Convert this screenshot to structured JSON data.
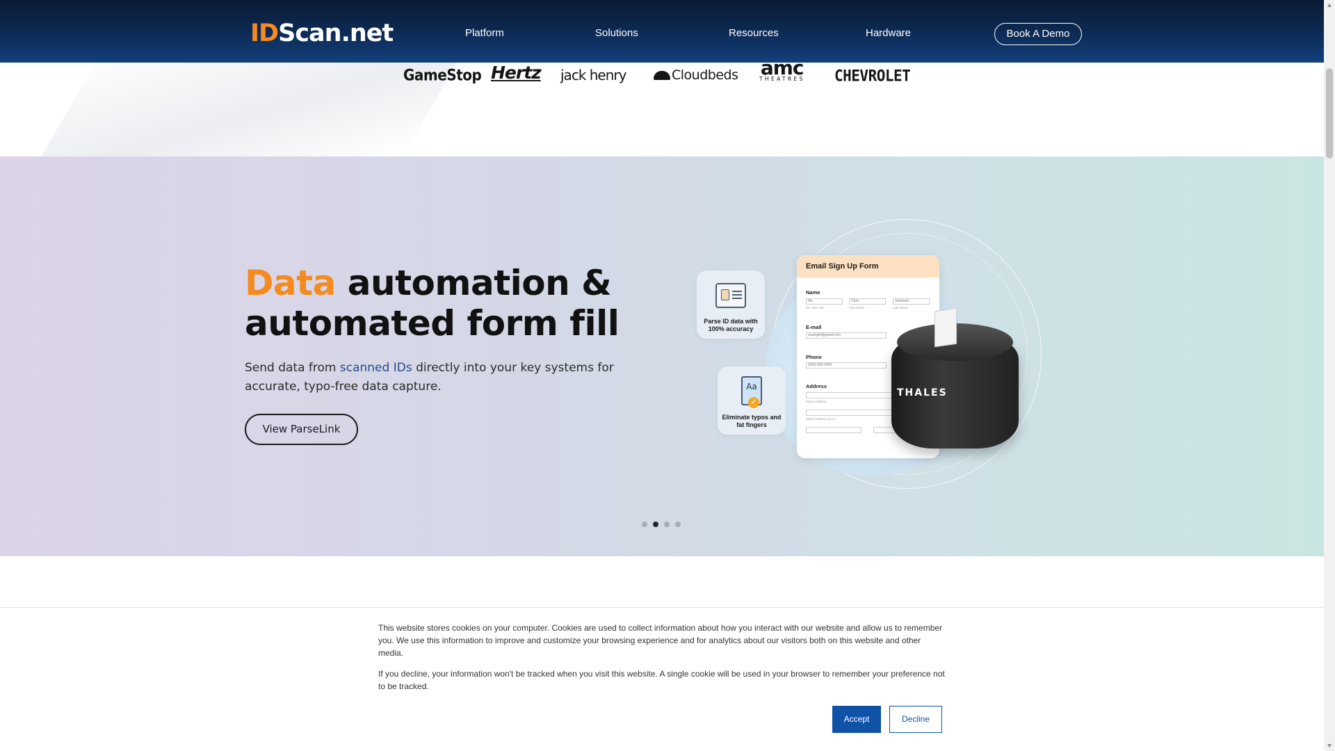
{
  "header": {
    "logo_id": "ID",
    "logo_rest": "Scan.net",
    "nav": [
      "Platform",
      "Solutions",
      "Resources",
      "Hardware"
    ],
    "cta": "Book A Demo"
  },
  "logos": {
    "items": [
      "GameStop",
      "Hertz",
      "jack henry",
      "Cloudbeds",
      "amc",
      "THEATRES",
      "CHEVROLET"
    ]
  },
  "hero": {
    "title_accent": "Data",
    "title_line1_rest": " automation &",
    "title_line2": "automated form fill",
    "subtitle_before": "Send data from ",
    "subtitle_link": "scanned IDs",
    "subtitle_after": " directly into your key systems for accurate, typo-free data capture.",
    "button": "View ParseLink",
    "carousel": {
      "count": 4,
      "active_index": 1
    }
  },
  "illustration": {
    "card1_text": "Parse ID data with 100% accuracy",
    "card2_icon_text": "Aa",
    "card2_text": "Eliminate typos and fat fingers",
    "form_title": "Email Sign Up Form",
    "label_name": "Name",
    "name_values": [
      "Ms.",
      "Chris",
      "Jameson"
    ],
    "name_hints": [
      "Mr / Mrs / Ms",
      "First Name",
      "Last Name"
    ],
    "label_email": "E-mail",
    "email_value": "example@gmail.com",
    "label_phone": "Phone",
    "phone_value": "(000) 000-0000",
    "label_address": "Address",
    "address_hints": [
      "Street Address",
      "Street Address Line 2"
    ],
    "scanner_brand": "THALES"
  },
  "cookie": {
    "text1": "This website stores cookies on your computer. Cookies are used to collect information about how you interact with our website and allow us to remember you. We use this information to improve and customize your browsing experience and for analytics about our visitors both on this website and other media.",
    "text2": "If you decline, your information won't be tracked when you visit this website. A single cookie will be used in your browser to remember your preference not to be tracked.",
    "accept": "Accept",
    "decline": "Decline"
  },
  "colors": {
    "brand_orange": "#f58a1f",
    "nav_blue": "#0d2b56",
    "button_blue": "#0f52a8",
    "link_blue": "#274b8a"
  }
}
